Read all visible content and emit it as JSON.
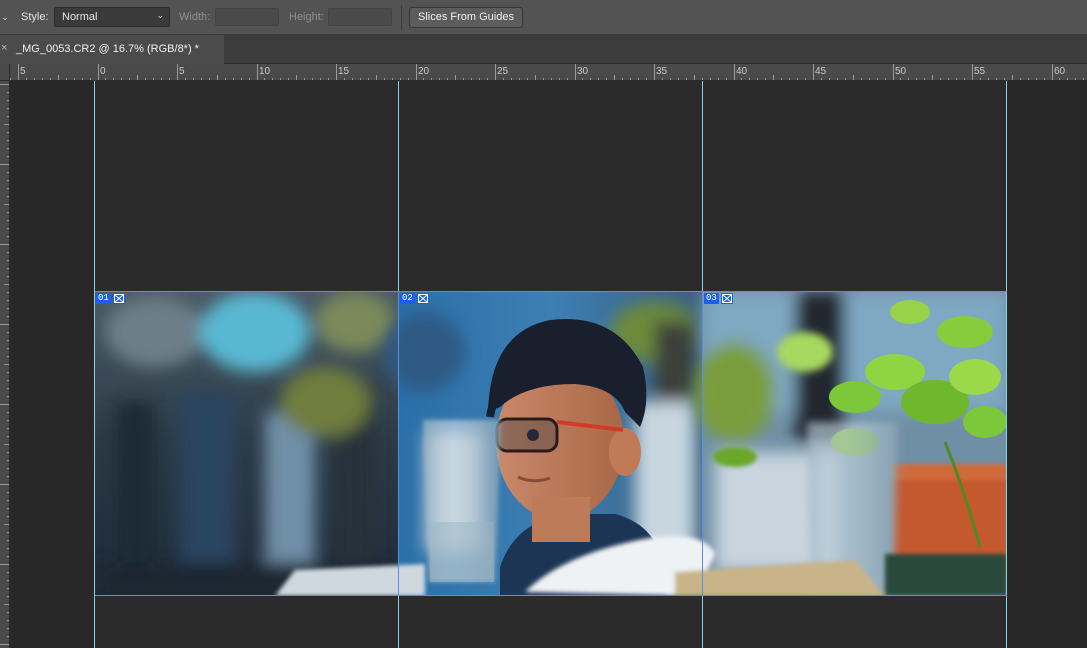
{
  "options_bar": {
    "style_label": "Style:",
    "style_value": "Normal",
    "width_label": "Width:",
    "height_label": "Height:",
    "slices_button": "Slices From Guides"
  },
  "tab": {
    "title": "_MG_0053.CR2 @ 16.7% (RGB/8*) *",
    "close_glyph": "×"
  },
  "ruler": {
    "labels": [
      "5",
      "0",
      "5",
      "10",
      "15",
      "20",
      "25",
      "30",
      "35",
      "40",
      "45",
      "50",
      "55",
      "60"
    ]
  },
  "slices": [
    {
      "number": "01"
    },
    {
      "number": "02"
    },
    {
      "number": "03"
    }
  ],
  "colors": {
    "guide": "#7fd8e8",
    "slice_border": "#5b8fe6",
    "slice_badge": "#1b5ff0"
  }
}
